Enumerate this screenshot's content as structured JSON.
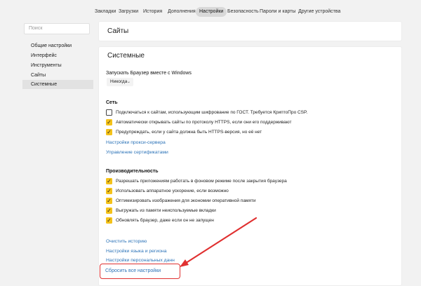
{
  "topnav": {
    "tabs": [
      {
        "label": "Закладки"
      },
      {
        "label": "Загрузки"
      },
      {
        "label": "История"
      },
      {
        "label": "Дополнения"
      },
      {
        "label": "Настройки",
        "active": true
      },
      {
        "label": "Безопасность"
      },
      {
        "label": "Пароли и карты"
      },
      {
        "label": "Другие устройства"
      }
    ]
  },
  "sidebar": {
    "search_placeholder": "Поиск",
    "items": [
      {
        "label": "Общие настройки"
      },
      {
        "label": "Интерфейс"
      },
      {
        "label": "Инструменты"
      },
      {
        "label": "Сайты"
      },
      {
        "label": "Системные",
        "active": true
      }
    ]
  },
  "sites_panel": {
    "title": "Сайты"
  },
  "system_panel": {
    "title": "Системные",
    "startup": {
      "label": "Запускать Браузер вместе с Windows",
      "selected": "Никогда"
    },
    "network": {
      "heading": "Сеть",
      "options": [
        {
          "label": "Подключаться к сайтам, использующим шифрование по ГОСТ. Требуется КриптоПро CSP.",
          "checked": false
        },
        {
          "label": "Автоматически открывать сайты по протоколу HTTPS, если они его поддерживают",
          "checked": true
        },
        {
          "label": "Предупреждать, если у сайта должна быть HTTPS-версия, но её нет",
          "checked": true
        }
      ],
      "links": [
        "Настройки прокси-сервера",
        "Управление сертификатами"
      ]
    },
    "performance": {
      "heading": "Производительность",
      "options": [
        {
          "label": "Разрешать приложениям работать в фоновом режиме после закрытия браузера",
          "checked": true
        },
        {
          "label": "Использовать аппаратное ускорение, если возможно",
          "checked": true
        },
        {
          "label": "Оптимизировать изображения для экономии оперативной памяти",
          "checked": true
        },
        {
          "label": "Выгружать из памяти неиспользуемые вкладки",
          "checked": true
        },
        {
          "label": "Обновлять браузер, даже если он не запущен",
          "checked": true
        }
      ]
    },
    "bottom_links": [
      "Очистить историю",
      "Настройки языка и региона",
      "Настройки персональных данн"
    ],
    "reset_label": "Сбросить все настройки"
  },
  "colors": {
    "accent_checkbox": "#f4c21a",
    "link": "#2c73b8",
    "annotation_red": "#e03030"
  }
}
